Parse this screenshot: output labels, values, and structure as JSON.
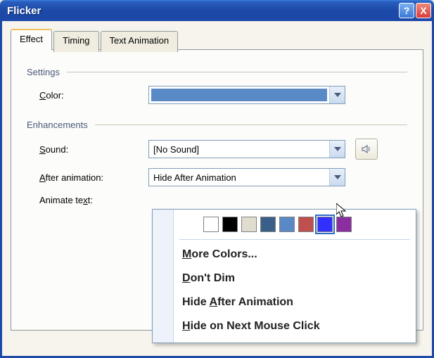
{
  "window": {
    "title": "Flicker"
  },
  "tabs": {
    "effect": "Effect",
    "timing": "Timing",
    "text_animation": "Text Animation"
  },
  "groups": {
    "settings": "Settings",
    "enhancements": "Enhancements"
  },
  "labels": {
    "color": "Color:",
    "sound": "Sound:",
    "after_animation": "After animation:",
    "animate_text": "Animate text:"
  },
  "values": {
    "sound": "[No Sound]",
    "after_animation": "Hide After Animation"
  },
  "dropdown": {
    "colors": [
      "#ffffff",
      "#000000",
      "#e0ddd0",
      "#3a5f88",
      "#5a8ac6",
      "#c0504d",
      "#3030ff",
      "#8a2ea0"
    ],
    "selected_color_index": 6,
    "more_colors": "More Colors...",
    "dont_dim": "Don't Dim",
    "hide_after": "Hide After Animation",
    "hide_next": "Hide on Next Mouse Click"
  },
  "icons": {
    "help": "?",
    "close": "X"
  }
}
